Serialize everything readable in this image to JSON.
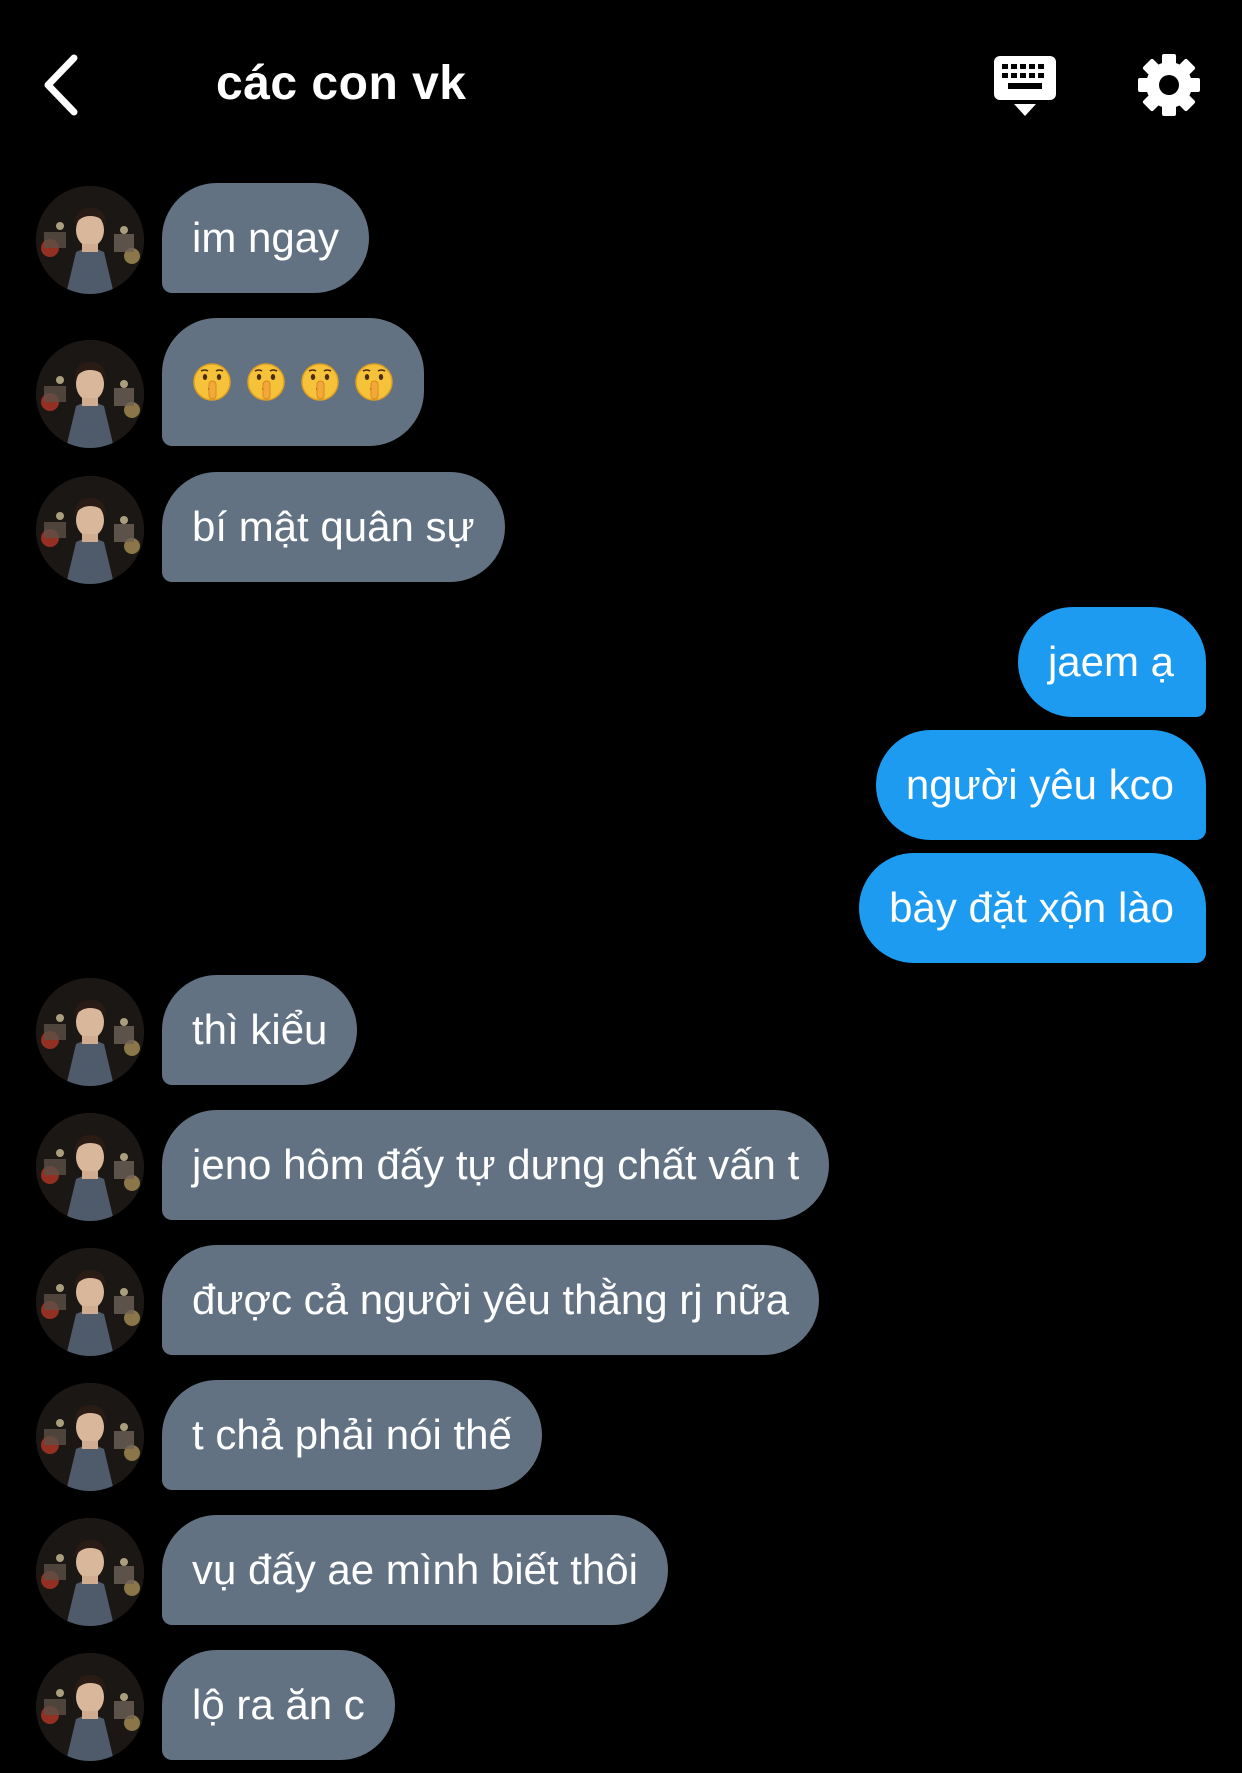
{
  "header": {
    "title": "các con vk",
    "back_icon": "chevron-left-icon",
    "keyboard_icon": "keyboard-icon",
    "settings_icon": "gear-icon"
  },
  "colors": {
    "background": "#000000",
    "incoming_bubble": "#637282",
    "outgoing_bubble": "#1d9bf0",
    "text": "#ffffff"
  },
  "messages": [
    {
      "side": "in",
      "text": "im ngay"
    },
    {
      "side": "in",
      "text": "🤫🤫🤫🤫",
      "emoji": "shushing-face",
      "count": 4
    },
    {
      "side": "in",
      "text": "bí mật quân sự"
    },
    {
      "side": "out",
      "text": "jaem ạ"
    },
    {
      "side": "out",
      "text": "người yêu kco"
    },
    {
      "side": "out",
      "text": "bày đặt xộn lào"
    },
    {
      "side": "in",
      "text": "thì kiểu"
    },
    {
      "side": "in",
      "text": "jeno hôm đấy tự dưng chất vấn t"
    },
    {
      "side": "in",
      "text": "được cả người yêu thằng rj nữa"
    },
    {
      "side": "in",
      "text": "t chả phải nói thế"
    },
    {
      "side": "in",
      "text": "vụ đấy ae mình biết thôi"
    },
    {
      "side": "in",
      "text": "lộ ra ăn c"
    }
  ]
}
